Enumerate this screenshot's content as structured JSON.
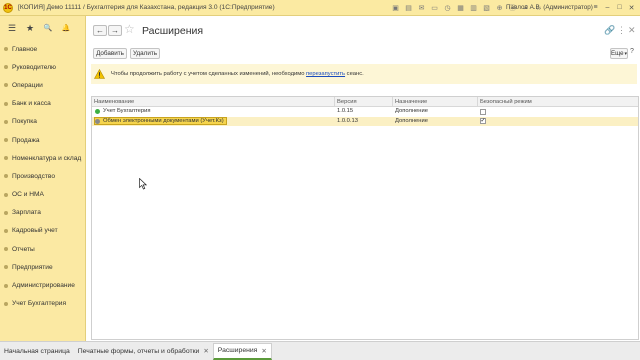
{
  "window": {
    "title": "[КОПИЯ] Демо 11111 / Бухгалтерия для Казахстана, редакция 3.0  (1С:Предприятие)",
    "logo_text": "1С",
    "user": "Павлов А.В. (Администратор)",
    "toolbar_icons": [
      "save-icon",
      "print-icon",
      "mail-icon",
      "bookmark-icon",
      "history-icon",
      "calc-icon",
      "calendar-icon",
      "compare-icon",
      "zoom-icon",
      "info-icon",
      "bell-icon",
      "star-icon"
    ],
    "controls": {
      "menu": "≡",
      "minimize": "–",
      "maximize": "□",
      "close": "✕"
    }
  },
  "sidebar": {
    "top_icons": {
      "menu": "☰",
      "favorites": "★",
      "search": "🔍",
      "notifications": "🔔"
    },
    "items": [
      {
        "label": "Главное"
      },
      {
        "label": "Руководителю"
      },
      {
        "label": "Операции"
      },
      {
        "label": "Банк и касса"
      },
      {
        "label": "Покупка"
      },
      {
        "label": "Продажа"
      },
      {
        "label": "Номенклатура и склад"
      },
      {
        "label": "Производство"
      },
      {
        "label": "ОС и НМА"
      },
      {
        "label": "Зарплата"
      },
      {
        "label": "Кадровый учет"
      },
      {
        "label": "Отчеты"
      },
      {
        "label": "Предприятие"
      },
      {
        "label": "Администрирование"
      },
      {
        "label": "Учет Бухгалтерия"
      }
    ]
  },
  "page": {
    "title": "Расширения",
    "nav": {
      "back": "←",
      "forward": "→"
    },
    "star": "☆",
    "more_controls": {
      "link": "🔗",
      "options": "⋮",
      "close": "✕"
    }
  },
  "toolbar": {
    "add_label": "Добавить",
    "delete_label": "Удалить",
    "more_label": "Еще",
    "more_arrow": "▾",
    "help_label": "?"
  },
  "warning": {
    "icon": "warning-icon",
    "text_before": "Чтобы продолжить работу с учетом сделанных изменений, необходимо ",
    "link_text": "перезапустить",
    "text_after": " сеанс."
  },
  "table": {
    "columns": [
      "Наименование",
      "Версия",
      "Назначение",
      "Безопасный режим"
    ],
    "rows": [
      {
        "name": "Учет Бухгалтерия",
        "version": "1.0.15",
        "purpose": "Дополнение",
        "safe_mode": false,
        "status_color": "#3cb043",
        "selected": false
      },
      {
        "name": "Обмен электронными документами (Учет.Кз)",
        "version": "1.0.0.13",
        "purpose": "Дополнение",
        "safe_mode": true,
        "status_color": "#8a8a8a",
        "selected": true
      }
    ]
  },
  "tabs": [
    {
      "label": "Начальная страница",
      "closable": false,
      "active": false
    },
    {
      "label": "Печатные формы, отчеты и обработки",
      "closable": true,
      "active": false
    },
    {
      "label": "Расширения",
      "closable": true,
      "active": true
    }
  ],
  "colors": {
    "sidebar_bg": "#fbe9a3",
    "titlebar_bg": "#fbeaa2",
    "warning_bg": "#fdf6d6",
    "selected_row_bg": "#fbf0c4",
    "focused_cell_bg": "#f5d44d",
    "link": "#1a4cbe",
    "active_tab_accent": "#5b9a3a"
  }
}
